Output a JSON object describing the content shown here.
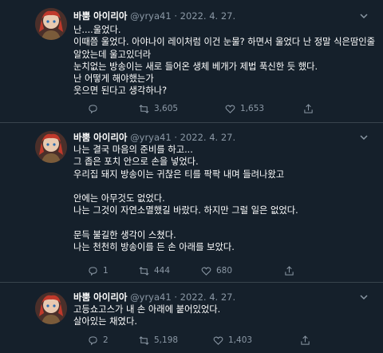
{
  "colors": {
    "background": "#15202b",
    "text": "#ffffff",
    "muted": "#8b98a5",
    "divider": "#38444d"
  },
  "tweets": [
    {
      "author_name": "바뿜 아이리아",
      "handle": "@yrya41",
      "separator": "·",
      "date": "2022. 4. 27.",
      "lines": [
        "난....울었다.",
        "이때쯤 울었다. 아야나이 레이처럼 이건 눈물? 하면서 울었다 난 정말 식은땀인줄",
        "알았는데 울고있더라",
        "눈치없는 방송이는 새로 들어온 생체 베개가 제법 푹신한 듯 했다.",
        "난 어떻게 해야했는가",
        "웃으면 된다고 생각하나?"
      ],
      "reply_icon": "reply-icon",
      "replies": "",
      "retweets": "3,605",
      "likes": "1,653"
    },
    {
      "author_name": "바뿜 아이리아",
      "handle": "@yrya41",
      "separator": "·",
      "date": "2022. 4. 27.",
      "lines": [
        "나는 결국 마음의 준비를 하고...",
        "그 좁은 포치 안으로 손을 넣었다.",
        "우리집 돼지 방송이는 귀찮은 티를 팍팍 내며 들려나왔고",
        "",
        "안에는 아무것도 없었다.",
        "나는 그것이 자연소멸했길 바랐다. 하지만 그럴 일은 없었다.",
        "",
        "문득 불길한 생각이 스쳤다.",
        "나는 천천히 방송이를 든 손 아래를 보았다."
      ],
      "replies": "1",
      "retweets": "444",
      "likes": "680"
    },
    {
      "author_name": "바뿜 아이리아",
      "handle": "@yrya41",
      "separator": "·",
      "date": "2022. 4. 27.",
      "lines": [
        "고등쇼고스가 내 손 아래에 붙어있었다.",
        "살아있는 채였다."
      ],
      "replies": "2",
      "retweets": "5,198",
      "likes": "1,403"
    }
  ]
}
